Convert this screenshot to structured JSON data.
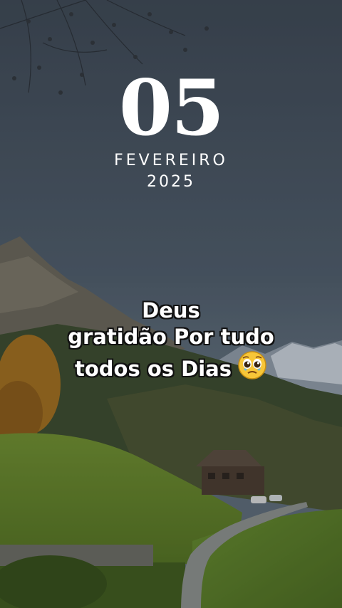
{
  "date": {
    "day": "05",
    "month": "FEVEREIRO",
    "year": "2025"
  },
  "message": {
    "line1": "Deus",
    "line2": "gratidão Por tudo",
    "line3": "todos os Dias",
    "emoji": "pleading-face-with-tears-icon"
  },
  "colors": {
    "text": "#ffffff",
    "sky": "#4c5866",
    "grass": "#7a9a3a"
  }
}
